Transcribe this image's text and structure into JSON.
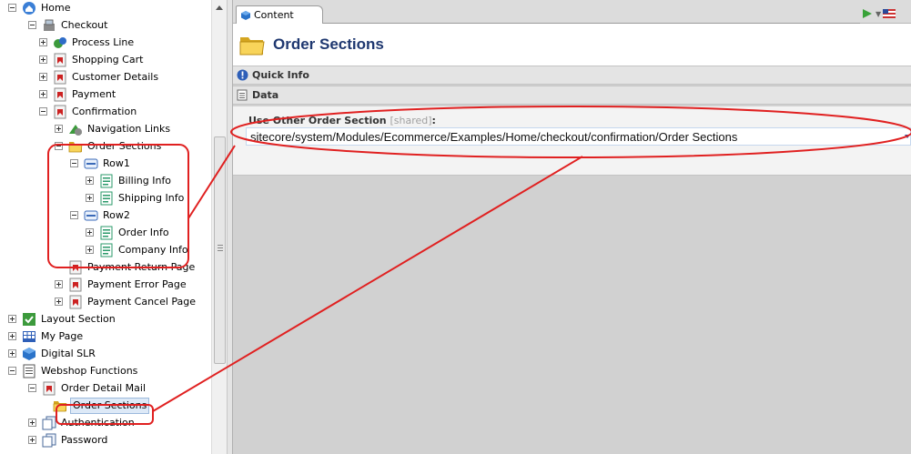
{
  "tree": {
    "items": [
      {
        "label": "Home",
        "icon": "home-icon",
        "expander": "minus"
      },
      {
        "label": "Checkout",
        "icon": "cash-register-icon",
        "expander": "minus"
      },
      {
        "label": "Process Line",
        "icon": "process-icon",
        "expander": "plus"
      },
      {
        "label": "Shopping Cart",
        "icon": "page-red-icon",
        "expander": "plus"
      },
      {
        "label": "Customer Details",
        "icon": "page-red-icon",
        "expander": "plus"
      },
      {
        "label": "Payment",
        "icon": "page-red-icon",
        "expander": "plus"
      },
      {
        "label": "Confirmation",
        "icon": "page-red-icon",
        "expander": "minus"
      },
      {
        "label": "Navigation Links",
        "icon": "navigation-links-icon",
        "expander": "plus"
      },
      {
        "label": "Order Sections",
        "icon": "folder-icon",
        "expander": "minus"
      },
      {
        "label": "Row1",
        "icon": "row-icon",
        "expander": "minus"
      },
      {
        "label": "Billing Info",
        "icon": "form-icon",
        "expander": "plus"
      },
      {
        "label": "Shipping Info",
        "icon": "form-icon",
        "expander": "plus"
      },
      {
        "label": "Row2",
        "icon": "row-icon",
        "expander": "minus"
      },
      {
        "label": "Order Info",
        "icon": "form-icon",
        "expander": "plus"
      },
      {
        "label": "Company Info",
        "icon": "form-icon",
        "expander": "plus"
      },
      {
        "label": "Payment Return Page",
        "icon": "page-red-icon",
        "expander": "none"
      },
      {
        "label": "Payment Error Page",
        "icon": "page-red-icon",
        "expander": "plus"
      },
      {
        "label": "Payment Cancel Page",
        "icon": "page-red-icon",
        "expander": "plus"
      },
      {
        "label": "Layout Section",
        "icon": "layout-icon",
        "expander": "plus"
      },
      {
        "label": "My Page",
        "icon": "grid-icon",
        "expander": "plus"
      },
      {
        "label": "Digital SLR",
        "icon": "cube-icon",
        "expander": "plus"
      },
      {
        "label": "Webshop Functions",
        "icon": "document-icon",
        "expander": "minus"
      },
      {
        "label": "Order Detail Mail",
        "icon": "page-red-icon",
        "expander": "minus"
      },
      {
        "label": "Order Sections",
        "icon": "folder-icon",
        "expander": "none",
        "selected": true
      },
      {
        "label": "Authentication",
        "icon": "documents-icon",
        "expander": "plus"
      },
      {
        "label": "Password",
        "icon": "documents-icon",
        "expander": "plus"
      }
    ]
  },
  "tab": {
    "label": "Content"
  },
  "item": {
    "title": "Order Sections"
  },
  "sections": {
    "quick_info": "Quick Info",
    "data": "Data"
  },
  "field": {
    "label": "Use Other Order Section",
    "shared": "[shared]",
    "colon": ":",
    "value": "sitecore/system/Modules/Ecommerce/Examples/Home/checkout/confirmation/Order Sections"
  },
  "colors": {
    "annotation": "#e02020",
    "title": "#1f3870"
  }
}
